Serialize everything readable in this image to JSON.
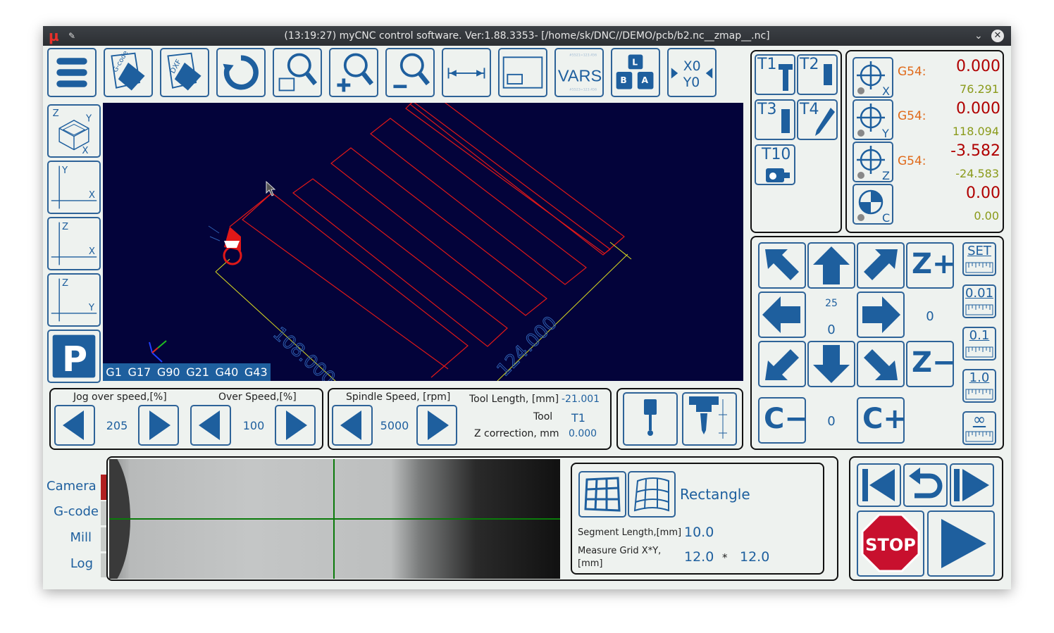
{
  "window": {
    "title": "(13:19:27) myCNC control software. Ver:1.88.3353- [/home/sk/DNC//DEMO/pcb/b2.nc__zmap__.nc]"
  },
  "toolbar": {
    "gcode_label": "G-code",
    "dxf_label": "DXF",
    "vars_label": "VARS",
    "x0_label": "X0",
    "y0_label": "Y0"
  },
  "views": {
    "iso": {
      "z": "Z",
      "y": "Y",
      "x": "X"
    },
    "xy": {
      "v": "Y",
      "h": "X"
    },
    "zx": {
      "v": "Z",
      "h": "X"
    },
    "zy": {
      "v": "Z",
      "h": "Y"
    },
    "park": "P"
  },
  "viewport": {
    "gcodes": [
      "G1",
      "G17",
      "G90",
      "G21",
      "G40",
      "G43"
    ],
    "dim_x": "108.000",
    "dim_y": "124.000"
  },
  "speeds": {
    "jog_label": "Jog over speed,[%]",
    "jog_value": "205",
    "over_label": "Over Speed,[%]",
    "over_value": "100",
    "spindle_label": "Spindle Speed, [rpm]",
    "spindle_value": "5000",
    "tool_length_label": "Tool Length, [mm]",
    "tool_length_value": "-21.001",
    "tool_label": "Tool",
    "tool_value": "T1",
    "zcorr_label": "Z correction, mm",
    "zcorr_value": "0.000"
  },
  "tools": [
    "T1",
    "T2",
    "T3",
    "T4",
    "T10"
  ],
  "coords": {
    "x": {
      "cs": "G54:",
      "work": "0.000",
      "machine": "76.291",
      "axis": "X"
    },
    "y": {
      "cs": "G54:",
      "work": "0.000",
      "machine": "118.094",
      "axis": "Y"
    },
    "z": {
      "cs": "G54:",
      "work": "-3.582",
      "machine": "-24.583",
      "axis": "Z"
    },
    "c": {
      "work": "0.00",
      "machine": "0.00",
      "axis": "C"
    }
  },
  "jog": {
    "zplus": "Z+",
    "zminus": "Z−",
    "cminus": "C−",
    "cplus": "C+",
    "speed_small": "25",
    "xy_value": "0",
    "z_value": "0",
    "c_value": "0",
    "steps": [
      "SET",
      "0.01",
      "0.1",
      "1.0",
      "∞"
    ]
  },
  "tabs": [
    "Camera",
    "G-code",
    "Mill",
    "Log"
  ],
  "probe": {
    "mode": "Rectangle",
    "seg_label": "Segment Length,[mm]",
    "seg_value": "10.0",
    "grid_label": "Measure Grid X*Y,",
    "grid_unit": "[mm]",
    "grid_x": "12.0",
    "grid_sep": "*",
    "grid_y": "12.0"
  },
  "control": {
    "stop_label": "STOP"
  },
  "colors": {
    "accent": "#1e5f9e",
    "viewport_bg": "#03033a",
    "stop": "#c8102e"
  }
}
